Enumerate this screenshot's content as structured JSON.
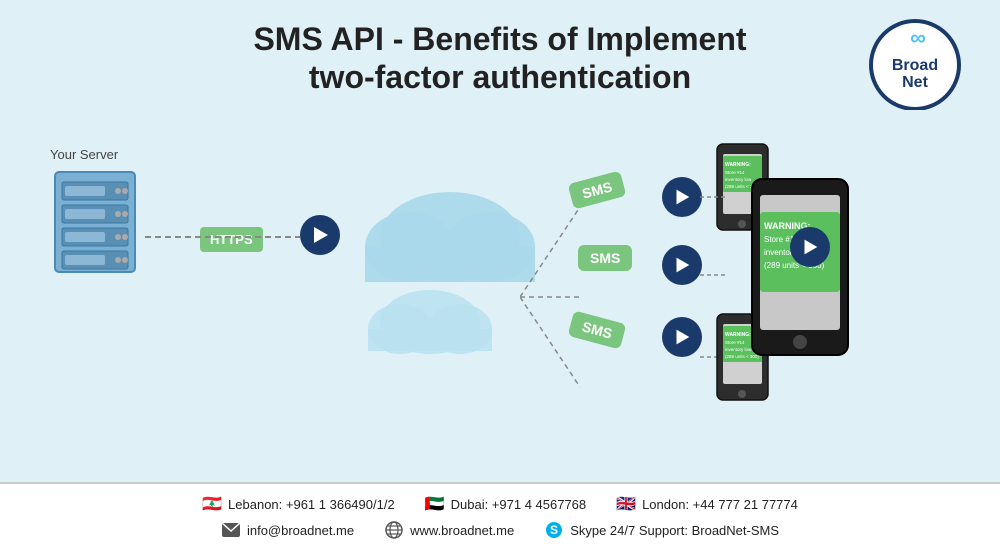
{
  "title": {
    "line1": "SMS API - Benefits of Implement",
    "line2": "two-factor authentication"
  },
  "logo": {
    "name": "Broad Net",
    "line1": "Broad",
    "line2": "Net"
  },
  "diagram": {
    "server_label": "Your Server",
    "https_label": "HTTPS",
    "sms_labels": [
      "SMS",
      "SMS",
      "SMS"
    ],
    "warning_large": "WARNING:\nStore #14\ninventory low\n(289 units < 300)",
    "warning_small": "WARNING:\nStore #14\ninventory low\n(289 units < 300)"
  },
  "footer": {
    "row1": [
      {
        "flag": "🇱🇧",
        "text": "Lebanon: +961 1 366490/1/2"
      },
      {
        "flag": "🇦🇪",
        "text": "Dubai: +971 4 4567768"
      },
      {
        "flag": "🇬🇧",
        "text": "London: +44 777 21 77774"
      }
    ],
    "row2": [
      {
        "icon": "envelope",
        "text": "info@broadnet.me"
      },
      {
        "icon": "globe",
        "text": "www.broadnet.me"
      },
      {
        "icon": "skype",
        "text": "Skype 24/7 Support: BroadNet-SMS"
      }
    ]
  }
}
